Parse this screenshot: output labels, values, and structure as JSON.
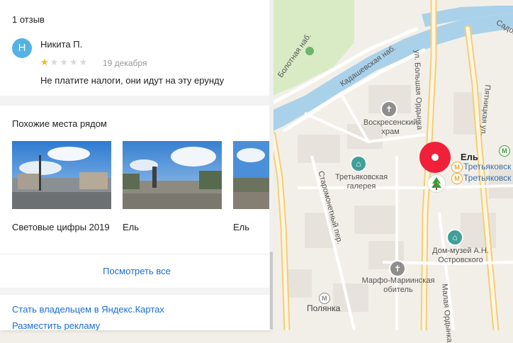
{
  "reviews": {
    "count_label": "1 отзыв",
    "items": [
      {
        "avatar_letter": "Н",
        "author": "Никита П.",
        "rating": 1,
        "rating_max": 5,
        "date": "19 декабря",
        "text": "Не платите налоги, они идут на эту ерунду"
      }
    ]
  },
  "similar": {
    "title": "Похожие места рядом",
    "items": [
      {
        "caption": "Световые цифры 2019"
      },
      {
        "caption": "Ель"
      },
      {
        "caption": "Ель"
      }
    ],
    "see_all": "Посмотреть все"
  },
  "footer": {
    "owner_link": "Стать владельцем в Яндекс.Картах",
    "ad_link": "Разместить рекламу"
  },
  "map": {
    "selected": {
      "name": "Ель",
      "pin_color": "#f0203a"
    },
    "streets": {
      "bolotnaya": "Болотная наб.",
      "kadashevskaya": "Кадашевская наб.",
      "bolshaya_ordynka": "ул. Большая Ордынка",
      "pyatnitskaya": "Пятницкая ул.",
      "staromonetny": "Старомонетный пер.",
      "malaya_ordynka": "Малая Ордынка",
      "top_right": "Садов"
    },
    "pois": {
      "church": "Воскресенский храм",
      "gallery": "Третьяковская галерея",
      "museum": "Дом-музей А.Н. Островского",
      "convent": "Марфо-Мариинская обитель"
    },
    "metro": {
      "tretyakovskaya_1": "Третьяковск",
      "tretyakovskaya_2": "Третьяковск",
      "polyanka": "Полянка",
      "icon_letter": "М",
      "line_color": "#e8a92a"
    }
  }
}
